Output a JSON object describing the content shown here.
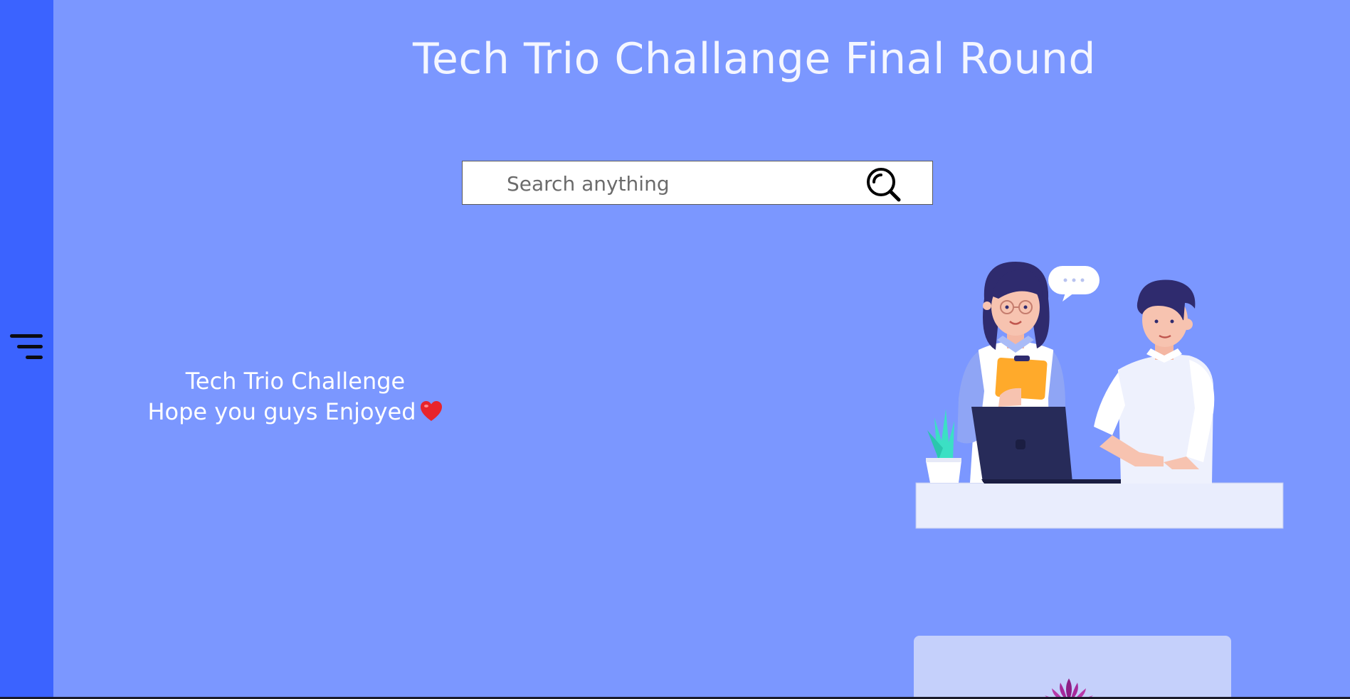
{
  "page": {
    "title": "Tech Trio Challange Final Round"
  },
  "search": {
    "placeholder": "Search anything"
  },
  "welcome": {
    "line1": "Tech Trio Challenge",
    "line2": "Hope you guys Enjoyed"
  },
  "icons": {
    "menu": "hamburger-menu-icon",
    "search": "search-icon",
    "heart": "heart-icon",
    "lotus": "lotus-icon"
  },
  "colors": {
    "sidebar": "#3b63ff",
    "background": "#7b97ff",
    "card": "#c5d0fb",
    "heart": "#e8242b"
  }
}
